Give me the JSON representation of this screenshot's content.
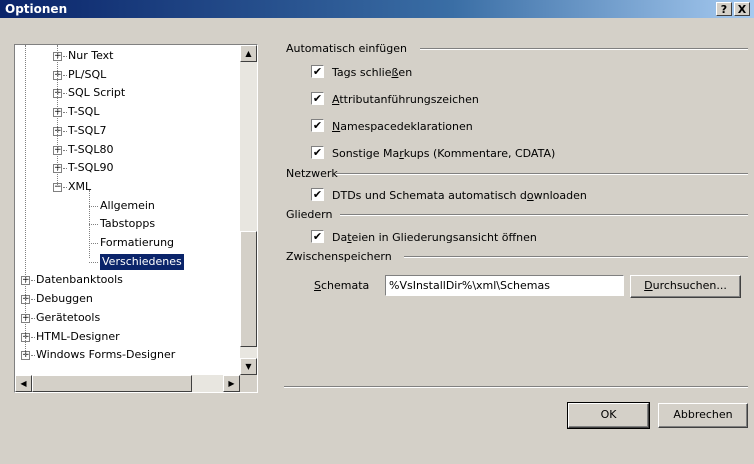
{
  "window": {
    "title": "Optionen",
    "help_label": "?",
    "close_label": "X"
  },
  "tree": {
    "items": [
      {
        "label": "Nur Text",
        "expander": "+"
      },
      {
        "label": "PL/SQL",
        "expander": "+"
      },
      {
        "label": "SQL Script",
        "expander": "+"
      },
      {
        "label": "T-SQL",
        "expander": "+"
      },
      {
        "label": "T-SQL7",
        "expander": "+"
      },
      {
        "label": "T-SQL80",
        "expander": "+"
      },
      {
        "label": "T-SQL90",
        "expander": "+"
      },
      {
        "label": "XML",
        "expander": "−"
      },
      {
        "label": "Allgemein"
      },
      {
        "label": "Tabstopps"
      },
      {
        "label": "Formatierung"
      },
      {
        "label": "Verschiedenes",
        "selected": true
      },
      {
        "label": "Datenbanktools",
        "expander": "+"
      },
      {
        "label": "Debuggen",
        "expander": "+"
      },
      {
        "label": "Gerätetools",
        "expander": "+"
      },
      {
        "label": "HTML-Designer",
        "expander": "+"
      },
      {
        "label": "Windows Forms-Designer",
        "expander": "+"
      }
    ]
  },
  "groups": {
    "autoinsert": "Automatisch einfügen",
    "network": "Netzwerk",
    "outline": "Gliedern",
    "cache": "Zwischenspeichern"
  },
  "checkboxes": {
    "close_tags": {
      "checked": true,
      "pre": "Tags schlie",
      "acc": "ß",
      "post": "en"
    },
    "attr_quotes": {
      "checked": true,
      "pre": "",
      "acc": "A",
      "post": "ttributanführungszeichen"
    },
    "ns_decl": {
      "checked": true,
      "pre": "",
      "acc": "N",
      "post": "amespacedeklarationen"
    },
    "other_markup": {
      "checked": true,
      "pre": "Sonstige Ma",
      "acc": "r",
      "post": "kups (Kommentare, CDATA)"
    },
    "dtd_download": {
      "checked": true,
      "pre": "DTDs und Schemata automatisch d",
      "acc": "o",
      "post": "wnloaden"
    },
    "open_outline": {
      "checked": true,
      "pre": "Da",
      "acc": "t",
      "post": "eien in Gliederungsansicht öffnen"
    }
  },
  "schemas": {
    "label_acc": "S",
    "label_rest": "chemata",
    "value": "%VsInstallDir%\\xml\\Schemas",
    "browse_acc": "D",
    "browse_rest": "urchsuchen..."
  },
  "footer": {
    "ok_label": "OK",
    "cancel_label": "Abbrechen"
  },
  "check_mark": "✔"
}
